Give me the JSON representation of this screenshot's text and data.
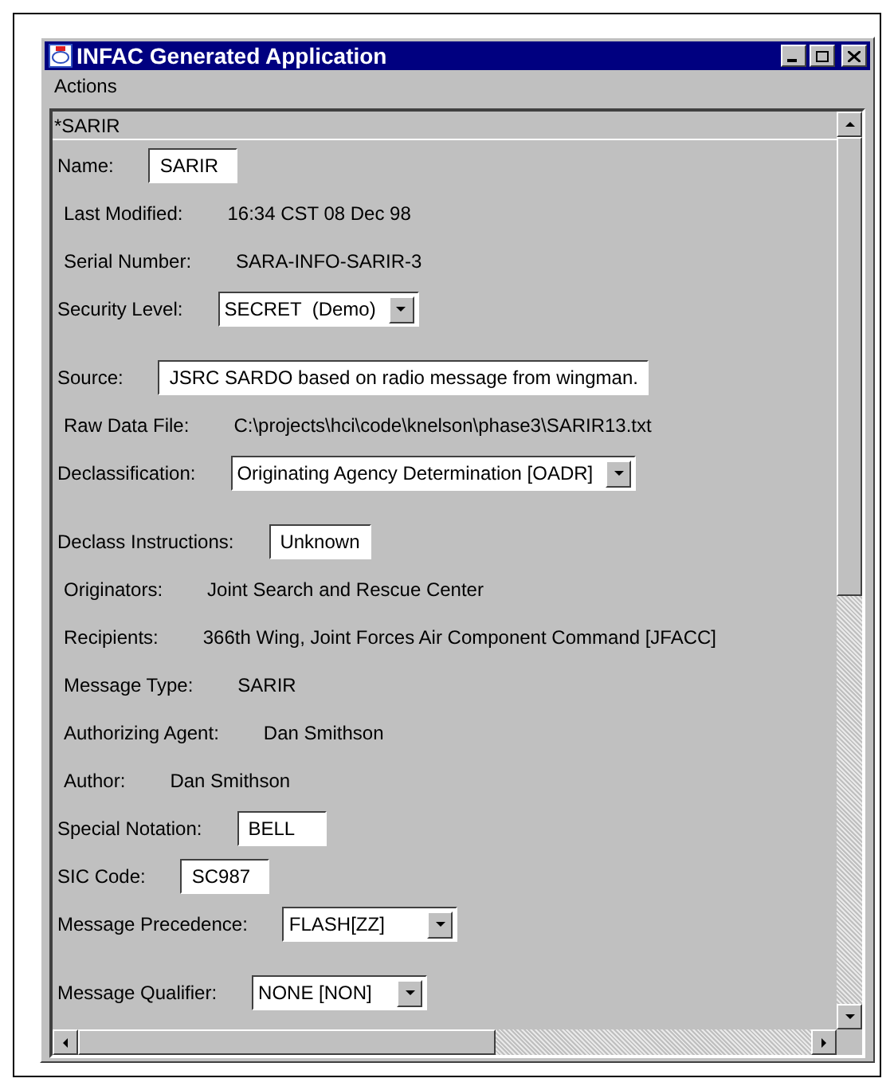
{
  "window": {
    "title": "INFAC Generated Application"
  },
  "menu": [
    "Actions"
  ],
  "panel": {
    "header": "*SARIR",
    "rows": [
      {
        "kind": "field",
        "label": "Name:",
        "value": "SARIR"
      },
      {
        "kind": "text",
        "label": "Last Modified:",
        "value": "16:34 CST 08 Dec 98"
      },
      {
        "kind": "text",
        "label": "Serial Number:",
        "value": "SARA-INFO-SARIR-3"
      },
      {
        "kind": "select",
        "label": "Security Level:",
        "value": "SECRET  (Demo)"
      },
      {
        "kind": "field",
        "label": "Source:",
        "value": "JSRC SARDO based on radio message from wingman."
      },
      {
        "kind": "text",
        "label": "Raw Data File:",
        "value": "C:\\projects\\hci\\code\\knelson\\phase3\\SARIR13.txt"
      },
      {
        "kind": "select",
        "label": "Declassification:",
        "value": "Originating Agency Determination [OADR]"
      },
      {
        "kind": "field",
        "label": "Declass Instructions:",
        "value": "Unknown"
      },
      {
        "kind": "text",
        "label": "Originators:",
        "value": "Joint Search and Rescue Center"
      },
      {
        "kind": "text",
        "label": "Recipients:",
        "value": "366th Wing, Joint Forces Air Component Command [JFACC]"
      },
      {
        "kind": "text",
        "label": "Message Type:",
        "value": "SARIR"
      },
      {
        "kind": "text",
        "label": "Authorizing Agent:",
        "value": "Dan Smithson"
      },
      {
        "kind": "text",
        "label": "Author:",
        "value": "Dan Smithson"
      },
      {
        "kind": "field",
        "label": "Special Notation:",
        "value": "BELL"
      },
      {
        "kind": "field",
        "label": "SIC Code:",
        "value": "SC987"
      },
      {
        "kind": "select",
        "label": "Message Precedence:",
        "value": "FLASH[ZZ]"
      },
      {
        "kind": "select",
        "label": "Message Qualifier:",
        "value": "NONE [NON]"
      }
    ]
  }
}
